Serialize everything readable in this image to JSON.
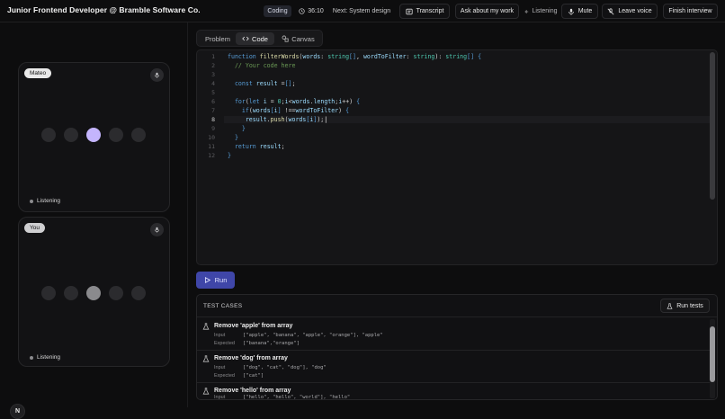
{
  "header": {
    "title": "Junior Frontend Developer @ Bramble Software Co.",
    "mode_badge": "Coding",
    "timer": "36:10",
    "next": "Next: System design",
    "buttons": {
      "transcript": "Transcript",
      "ask": "Ask about my work",
      "listening": "Listening",
      "mute": "Mute",
      "leave_voice": "Leave voice",
      "finish": "Finish interview"
    }
  },
  "participants": [
    {
      "name": "Mateo",
      "status": "Listening"
    },
    {
      "name": "You",
      "status": "Listening"
    }
  ],
  "logo_letter": "N",
  "tabs": [
    {
      "label": "Problem"
    },
    {
      "label": "Code"
    },
    {
      "label": "Canvas"
    }
  ],
  "editor": {
    "line_numbers": [
      "1",
      "2",
      "3",
      "4",
      "5",
      "6",
      "7",
      "8",
      "9",
      "10",
      "11",
      "12"
    ],
    "current_line": 8
  },
  "run_label": "Run",
  "tests": {
    "title": "TEST CASES",
    "run_tests_label": "Run tests",
    "input_label": "Input",
    "expected_label": "Expected",
    "cases": [
      {
        "name": "Remove 'apple' from array",
        "input": "[\"apple\", \"banana\", \"apple\", \"orange\"], \"apple\"",
        "expected": "[\"banana\",\"orange\"]"
      },
      {
        "name": "Remove 'dog' from array",
        "input": "[\"dog\", \"cat\", \"dog\"], \"dog\"",
        "expected": "[\"cat\"]"
      },
      {
        "name": "Remove 'hello' from array",
        "input": "[\"hello\", \"hello\", \"world\"], \"hello\"",
        "expected": ""
      }
    ]
  },
  "colors": {
    "accent": "#c4b5fd",
    "run_button": "#3f46a8",
    "background": "#0d0d0e"
  }
}
